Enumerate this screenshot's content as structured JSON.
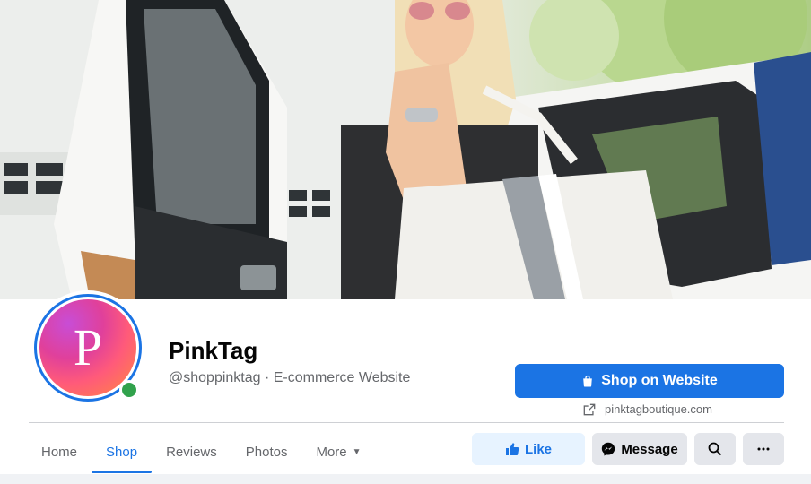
{
  "page": {
    "name": "PinkTag",
    "handle_category": "@shoppinktag · E-commerce Website",
    "avatar_letter": "P"
  },
  "cta": {
    "shop_label": "Shop on Website",
    "website": "pinktagboutique.com"
  },
  "tabs": [
    {
      "label": "Home",
      "active": false
    },
    {
      "label": "Shop",
      "active": true
    },
    {
      "label": "Reviews",
      "active": false
    },
    {
      "label": "Photos",
      "active": false
    },
    {
      "label": "More",
      "active": false
    }
  ],
  "actions": {
    "like": "Like",
    "message": "Message"
  },
  "icons": {
    "shop": "shopping-bag-icon",
    "link": "external-link-icon",
    "like": "thumbs-up-icon",
    "message": "messenger-icon",
    "search": "search-icon",
    "more": "ellipsis-icon",
    "dropdown": "caret-down-icon"
  },
  "colors": {
    "accent": "#1b74e4",
    "online": "#31a24c"
  }
}
